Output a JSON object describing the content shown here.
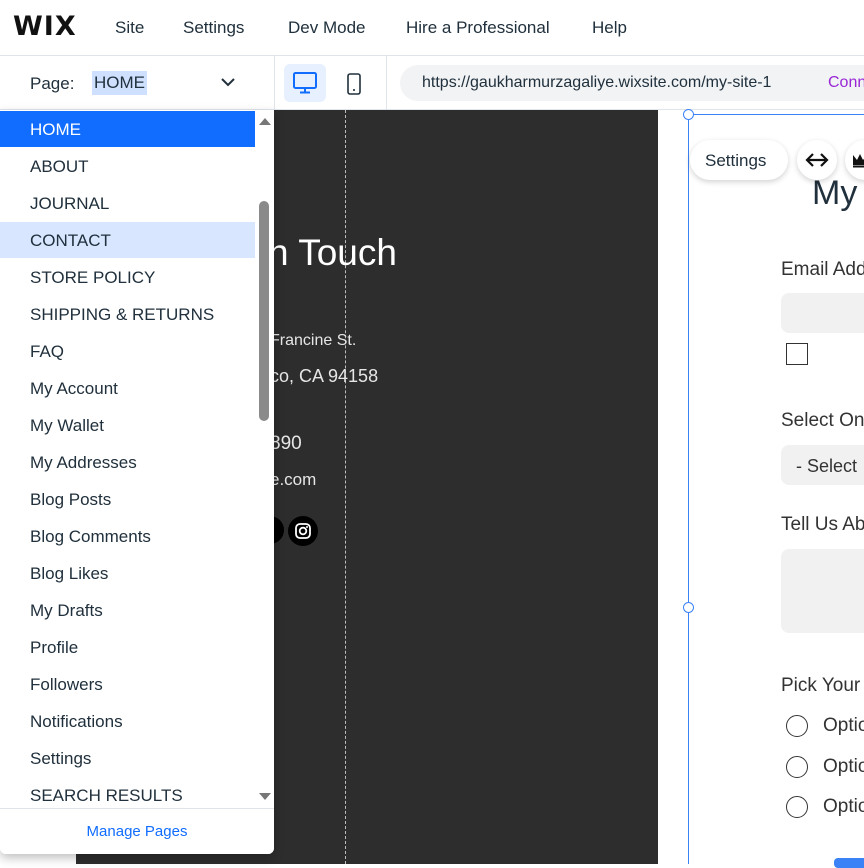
{
  "topbar": {
    "logo": "WIX",
    "menu": [
      "Site",
      "Settings",
      "Dev Mode",
      "Hire a Professional",
      "Help"
    ]
  },
  "pagebar": {
    "label": "Page:",
    "current_page": "HOME",
    "url": "https://gaukharmurzagaliye.wixsite.com/my-site-1",
    "url_suffix": "Conn"
  },
  "dropdown": {
    "pages": [
      "HOME",
      "ABOUT",
      "JOURNAL",
      "CONTACT",
      "STORE POLICY",
      "SHIPPING & RETURNS",
      "FAQ",
      "My Account",
      "My Wallet",
      "My Addresses",
      "Blog Posts",
      "Blog Comments",
      "Blog Likes",
      "My Drafts",
      "Profile",
      "Followers",
      "Notifications",
      "Settings",
      "SEARCH RESULTS"
    ],
    "selected": "HOME",
    "hovered": "CONTACT",
    "footer": "Manage Pages"
  },
  "canvas": {
    "heading_partial": "n Touch",
    "address_line1": "Francine St.",
    "address_line2": "co, CA 94158",
    "phone_partial": "890",
    "email_partial": "e.com"
  },
  "form": {
    "settings_label": "Settings",
    "title_partial": "My",
    "email_label": "Email Add",
    "select_label": "Select On",
    "select_placeholder": "- Select",
    "message_label": "Tell Us Ab",
    "pick_label": "Pick Your",
    "options": [
      "Optio",
      "Optio",
      "Optio"
    ]
  },
  "colors": {
    "accent": "#116dff",
    "canvas_dark": "#2d2d2d",
    "connect_purple": "#9a27d5"
  }
}
